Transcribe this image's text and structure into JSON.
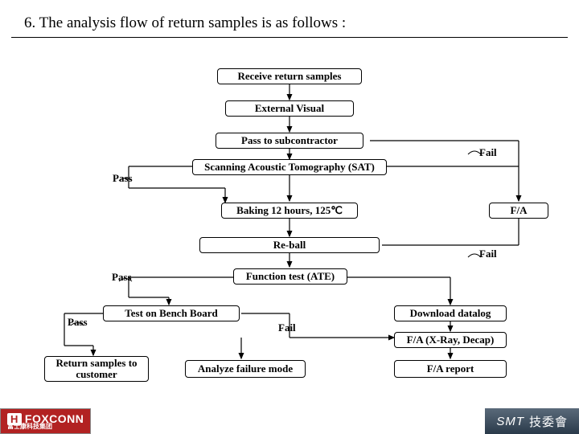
{
  "title": "6. The analysis flow of return samples is as follows :",
  "boxes": {
    "receive": "Receive return samples",
    "external": "External Visual",
    "subcontractor": "Pass to subcontractor",
    "sat": "Scanning Acoustic Tomography (SAT)",
    "baking": "Baking 12 hours, 125℃",
    "reball": "Re-ball",
    "functest": "Function test (ATE)",
    "bench": "Test on Bench Board",
    "return_cust": "Return samples to customer",
    "analyze": "Analyze failure mode",
    "fa": "F/A",
    "download": "Download datalog",
    "xray": "F/A (X-Ray, Decap)",
    "fareport": "F/A report"
  },
  "labels": {
    "fail1": "Fail",
    "fail2": "Fail",
    "fail3": "Fail",
    "pass1": "Pass",
    "pass2": "Pass",
    "pass3": "Pass"
  },
  "footer": {
    "left_brand": "FOXCONN",
    "left_sub": "富士康科技集团",
    "right_brand": "SMT",
    "right_cn": "技委會"
  }
}
